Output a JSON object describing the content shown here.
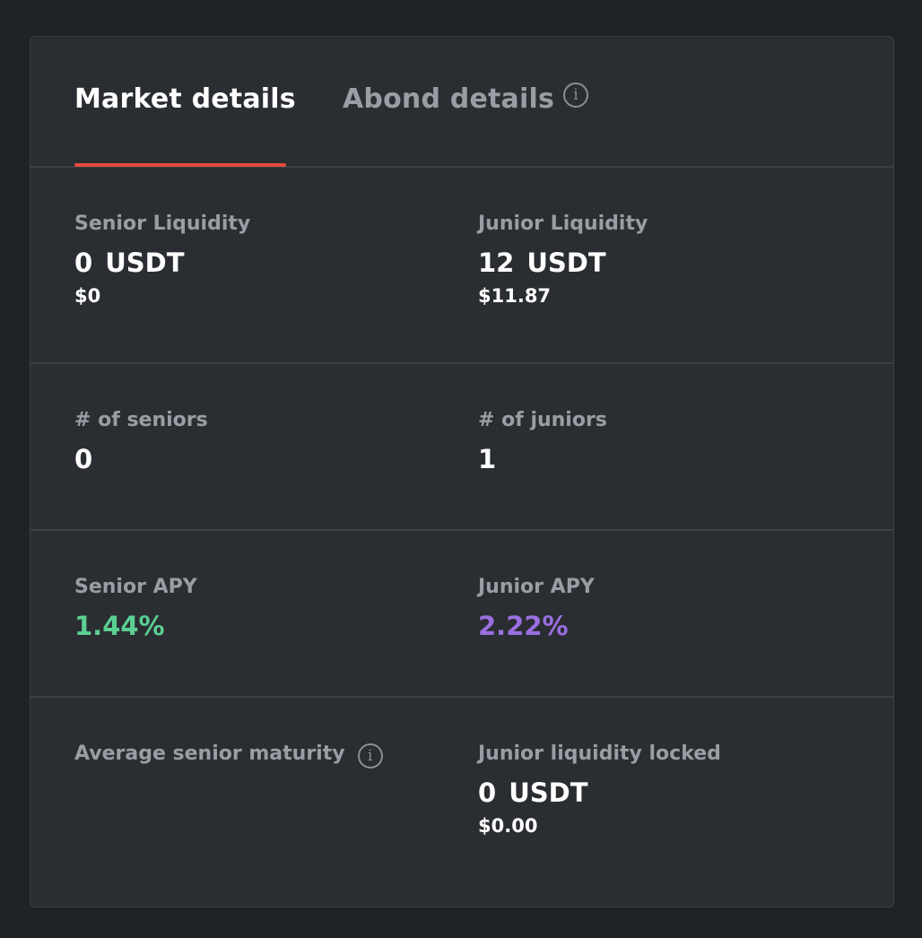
{
  "tabs": {
    "market": "Market details",
    "abond": "Abond details"
  },
  "colors": {
    "accent": "#e84c3d",
    "senior_apy": "#5ccf92",
    "junior_apy": "#9b6fe0"
  },
  "liquidity": {
    "senior": {
      "label": "Senior Liquidity",
      "amount": "0",
      "unit": "USDT",
      "usd": "$0"
    },
    "junior": {
      "label": "Junior Liquidity",
      "amount": "12",
      "unit": "USDT",
      "usd": "$11.87"
    }
  },
  "counts": {
    "seniors": {
      "label": "# of seniors",
      "value": "0"
    },
    "juniors": {
      "label": "# of juniors",
      "value": "1"
    }
  },
  "apy": {
    "senior": {
      "label": "Senior APY",
      "value": "1.44%"
    },
    "junior": {
      "label": "Junior APY",
      "value": "2.22%"
    }
  },
  "maturity": {
    "avg_label": "Average senior maturity",
    "locked": {
      "label": "Junior liquidity locked",
      "amount": "0",
      "unit": "USDT",
      "usd": "$0.00"
    }
  },
  "icons": {
    "info": "info-icon",
    "info_glyph": "i"
  }
}
